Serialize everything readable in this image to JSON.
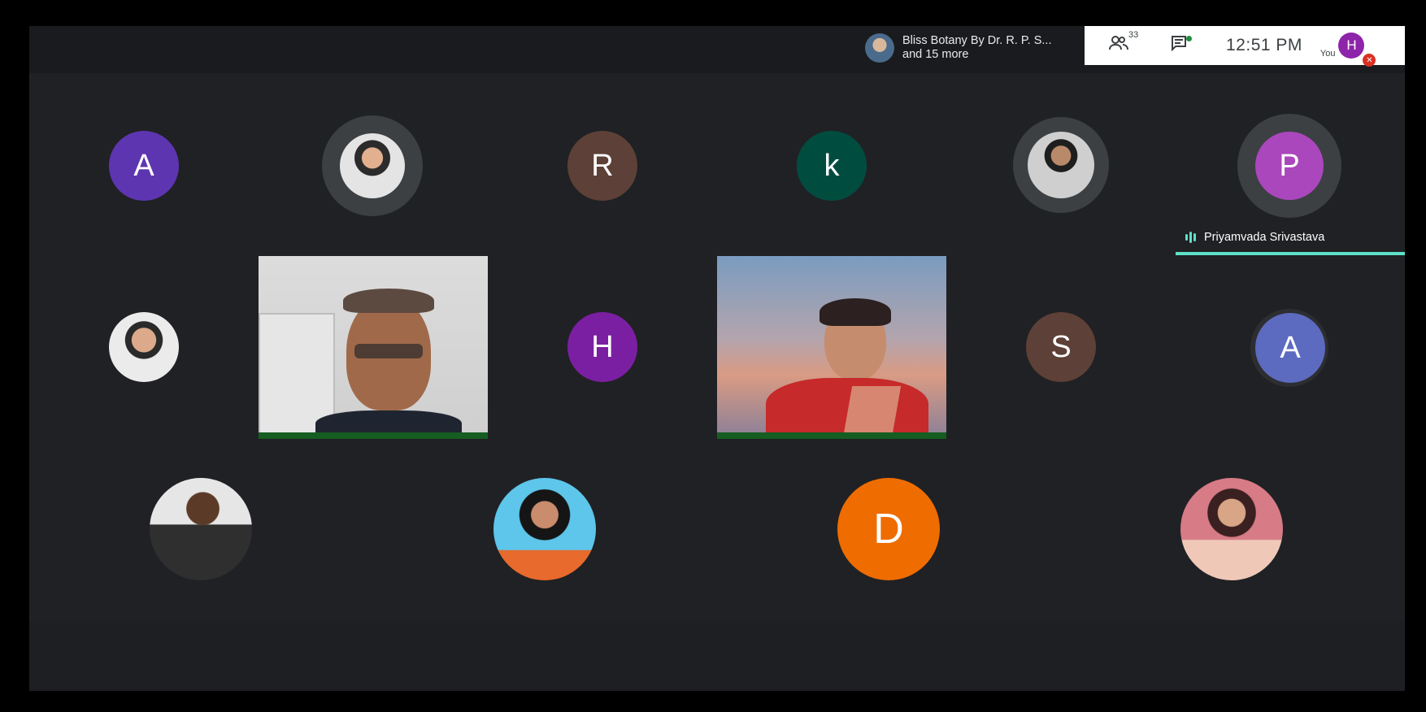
{
  "header": {
    "presenter_line1": "Bliss Botany By Dr. R. P. S...",
    "presenter_line2": "and 15 more",
    "participants_count": "33",
    "time": "12:51  PM",
    "you_label": "You",
    "self_initial": "H"
  },
  "icons": {
    "people": "people-icon",
    "chat": "chat-icon",
    "mic_off": "mic-off-icon"
  },
  "participants": {
    "row1": [
      {
        "initial": "A",
        "color": "#5e35b1"
      },
      {
        "type": "photo"
      },
      {
        "initial": "R",
        "color": "#5d4037"
      },
      {
        "initial": "k",
        "color": "#004d40"
      },
      {
        "type": "photo"
      },
      {
        "initial": "P",
        "color": "#ab47bc"
      }
    ],
    "row2": [
      {
        "type": "photo"
      },
      {
        "type": "video"
      },
      {
        "initial": "H",
        "color": "#7b1fa2"
      },
      {
        "type": "video"
      },
      {
        "initial": "S",
        "color": "#5d4037"
      },
      {
        "initial": "A",
        "color": "#5c6bc0"
      }
    ],
    "row3": [
      {
        "type": "photo"
      },
      {
        "type": "photo"
      },
      {
        "initial": "D",
        "color": "#ef6c00"
      },
      {
        "type": "photo"
      }
    ]
  },
  "active_speaker": {
    "name": "Priyamvada Srivastava",
    "accent": "#5ee0c9"
  }
}
